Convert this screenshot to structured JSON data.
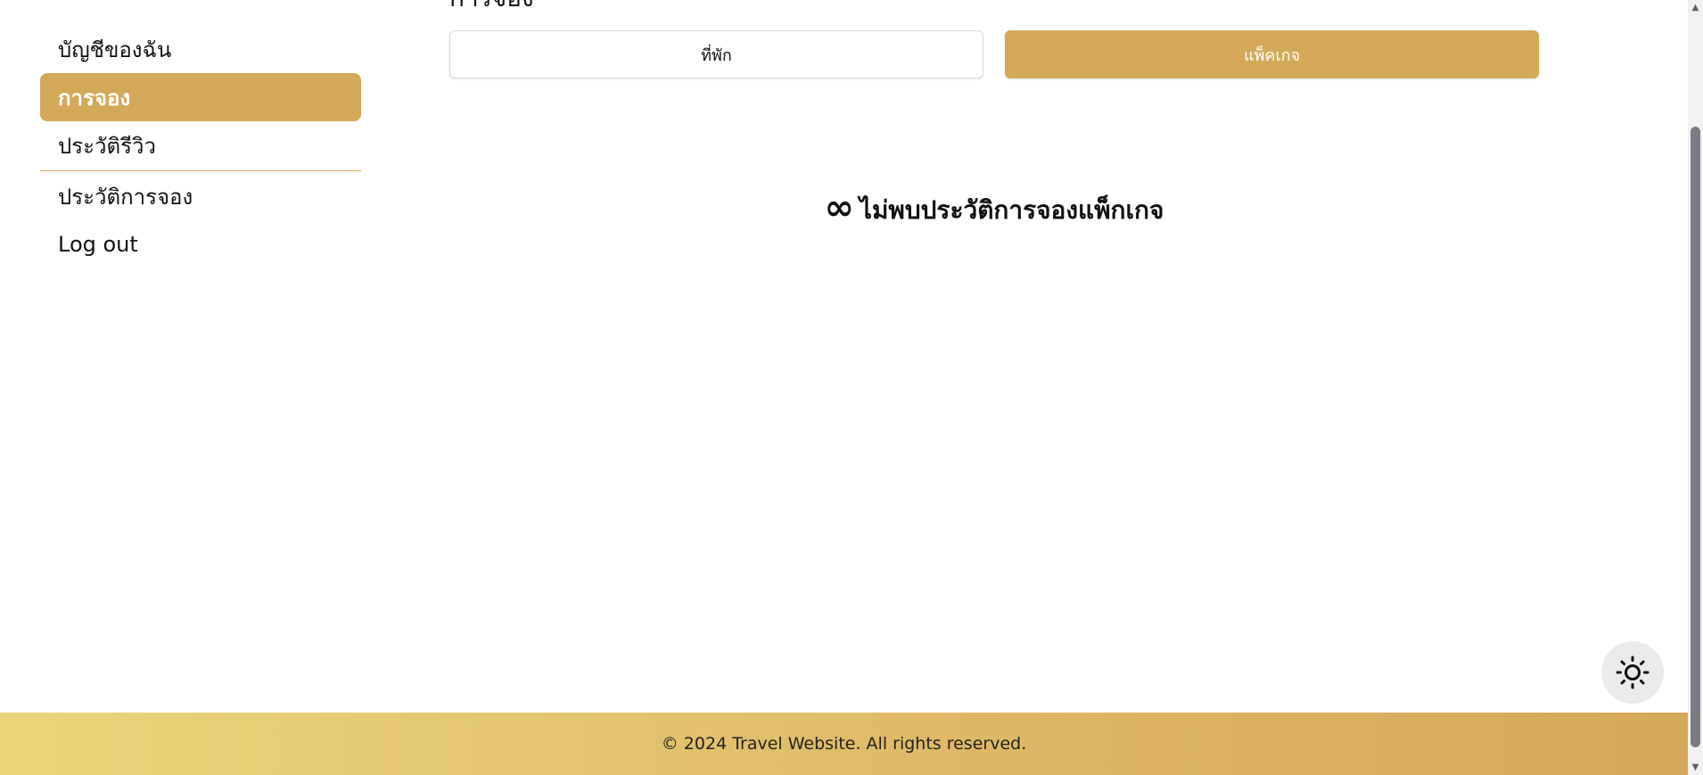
{
  "header": {
    "title": "การจอง"
  },
  "sidebar": {
    "items": [
      {
        "label": "บัญชีของฉัน"
      },
      {
        "label": "การจอง"
      },
      {
        "label": "ประวัติรีวิว"
      },
      {
        "label": "ประวัติการจอง"
      },
      {
        "label": "Log out"
      }
    ]
  },
  "tabs": [
    {
      "label": "ที่พัก"
    },
    {
      "label": "แพ็คเกจ"
    }
  ],
  "empty_state": {
    "icon": "infinity-icon",
    "symbol": "∞",
    "message": "ไม่พบประวัติการจองแพ็กเกจ"
  },
  "theme_toggle": {
    "icon": "sun-icon"
  },
  "footer": {
    "text": "© 2024 Travel Website. All rights reserved."
  },
  "colors": {
    "accent": "#d4a95a",
    "footer_start": "#ead57a",
    "footer_end": "#d4a95a"
  }
}
